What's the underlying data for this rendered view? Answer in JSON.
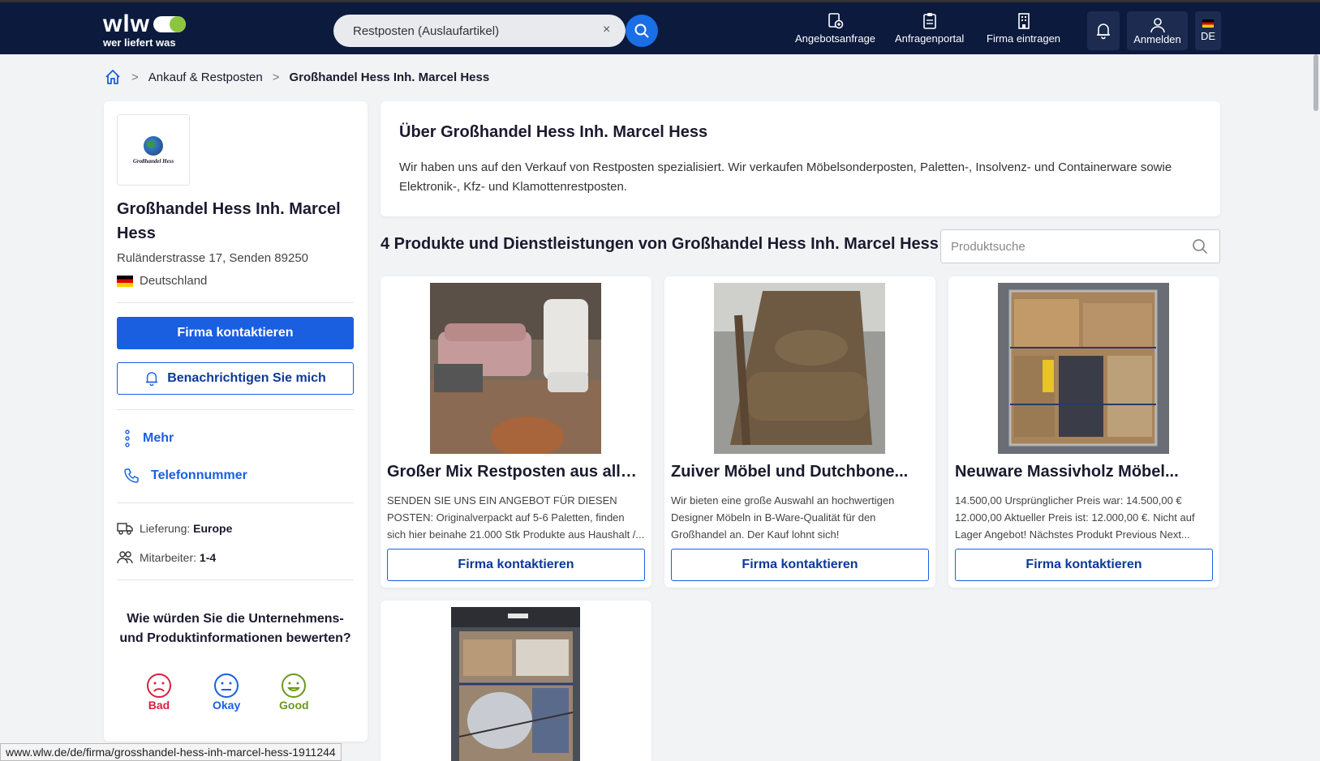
{
  "header": {
    "logo_word": "wlw",
    "logo_sub": "wer liefert was",
    "search_value": "Restposten (Auslaufartikel)",
    "clear_glyph": "×",
    "nav": [
      {
        "label": "Angebotsanfrage",
        "icon": "quote-request-icon"
      },
      {
        "label": "Anfragenportal",
        "icon": "clipboard-icon"
      },
      {
        "label": "Firma eintragen",
        "icon": "building-icon"
      }
    ],
    "login_label": "Anmelden",
    "lang_label": "DE"
  },
  "breadcrumb": {
    "items": [
      "Ankauf & Restposten",
      "Großhandel Hess Inh. Marcel Hess"
    ],
    "sep": ">"
  },
  "company": {
    "logo_text": "Großhandel Hess",
    "name": "Großhandel Hess Inh. Marcel Hess",
    "address": "Ruländerstrasse 17, Senden 89250",
    "country": "Deutschland",
    "contact_label": "Firma kontaktieren",
    "notify_label": "Benachrichtigen Sie mich",
    "more_label": "Mehr",
    "phone_label": "Telefonnummer",
    "delivery_label": "Lieferung:",
    "delivery_value": "Europe",
    "employees_label": "Mitarbeiter:",
    "employees_value": "1-4"
  },
  "rating": {
    "question": "Wie würden Sie die Unternehmens- und Produktinformationen bewerten?",
    "options": [
      {
        "label": "Bad",
        "color": "#d8203e"
      },
      {
        "label": "Okay",
        "color": "#1a5fe0"
      },
      {
        "label": "Good",
        "color": "#6a9a1a"
      }
    ]
  },
  "about": {
    "title": "Über Großhandel Hess Inh. Marcel Hess",
    "text": "Wir haben uns auf den Verkauf von Restposten spezialisiert. Wir verkaufen Möbelsonderposten, Paletten-, Insolvenz- und Containerware sowie Elektronik-, Kfz- und Klamottenrestposten."
  },
  "products": {
    "title": "4 Produkte und Dienstleistungen von Großhandel Hess Inh. Marcel Hess",
    "search_placeholder": "Produktsuche",
    "cta_label": "Firma kontaktieren",
    "items": [
      {
        "title": "Großer Mix Restposten aus allen...",
        "desc": "SENDEN SIE UNS EIN ANGEBOT FÜR DIESEN POSTEN: Originalverpackt auf 5-6 Paletten, finden sich hier beinahe 21.000 Stk Produkte aus Haushalt /..."
      },
      {
        "title": "Zuiver Möbel und Dutchbone...",
        "desc": "Wir bieten eine große Auswahl an hochwertigen Designer Möbeln in B-Ware-Qualität für den Großhandel an. Der Kauf lohnt sich!"
      },
      {
        "title": "Neuware Massivholz Möbel...",
        "desc": "14.500,00 Ursprünglicher Preis war: 14.500,00 € 12.000,00 Aktueller Preis ist: 12.000,00 €. Nicht auf Lager Angebot! Nächstes Produkt Previous Next..."
      }
    ]
  },
  "status_url": "www.wlw.de/de/firma/grosshandel-hess-inh-marcel-hess-1911244",
  "colors": {
    "header_bg": "#0b1a3d",
    "primary": "#1a5fe0",
    "accent": "#8cc63f"
  }
}
